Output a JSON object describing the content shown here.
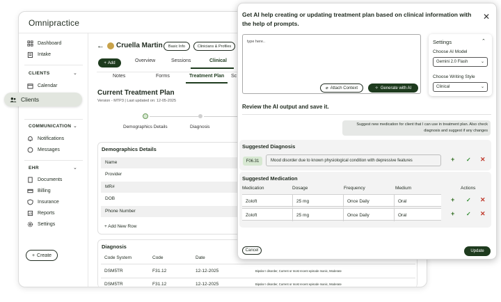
{
  "app": {
    "logo": "Omnipractice"
  },
  "sidebar": {
    "items": [
      {
        "label": "Dashboard",
        "icon": "grid-icon"
      },
      {
        "label": "Intake",
        "icon": "clipboard-icon"
      }
    ],
    "sections": [
      {
        "title": "CLIENTS",
        "items": [
          {
            "label": "Calendar",
            "icon": "calendar-icon"
          }
        ]
      },
      {
        "title": "COMMUNICATION",
        "items": [
          {
            "label": "Notifications",
            "icon": "bell-icon"
          },
          {
            "label": "Messages",
            "icon": "chat-icon"
          }
        ]
      },
      {
        "title": "EHR",
        "items": [
          {
            "label": "Documents",
            "icon": "document-icon"
          },
          {
            "label": "Billing",
            "icon": "billing-icon"
          },
          {
            "label": "Insurance",
            "icon": "shield-icon"
          },
          {
            "label": "Reports",
            "icon": "reports-icon"
          },
          {
            "label": "Settings",
            "icon": "gear-icon"
          }
        ]
      }
    ],
    "create_label": "Create",
    "clients_pill": "Clients"
  },
  "patient": {
    "name": "Cruella Martin",
    "basic_info": "Basic Info",
    "clinicians": "Clinicians & Profiles",
    "add_label": "Add"
  },
  "tabs_primary": [
    "Overview",
    "Sessions",
    "Clinical"
  ],
  "tabs_secondary": [
    "Notes",
    "Forms",
    "Treatment Plan",
    "Sc"
  ],
  "plan": {
    "title": "Current Treatment Plan",
    "version": "Version - MTP3 | Last updated on: 12-05-2025",
    "steps": [
      "Demographics Details",
      "Diagnosis"
    ]
  },
  "demographics": {
    "title": "Demographics Details",
    "rows": [
      "Name",
      "Provider",
      "MR#",
      "DOB",
      "Phone Number"
    ],
    "add_row": "+ Add New Row"
  },
  "diagnosis": {
    "title": "Diagnosis",
    "headers": [
      "Code System",
      "Code",
      "Date"
    ],
    "rows": [
      {
        "system": "DSM5TR",
        "code": "F31.12",
        "date": "12-12-2025",
        "desc": "Bipolar I disorder, Current or most recent episode manic, Moderate"
      },
      {
        "system": "DSM5TR",
        "code": "F31.12",
        "date": "12-12-2025",
        "desc": "Bipolar I disorder, Current or most recent episode manic, Moderate"
      }
    ]
  },
  "modal": {
    "title": "Get AI help creating or updating treatment plan based on clinical information with the help of prompts.",
    "prompt_placeholder": "type here..",
    "attach_label": "Attach Context",
    "generate_label": "Generate with AI",
    "settings": {
      "title": "Settings",
      "model_label": "Choose AI Model",
      "model_value": "Gemini 2.0 Flash",
      "style_label": "Choose Writing Style",
      "style_value": "Clinical"
    },
    "review_title": "Review the AI output and save it.",
    "user_prompt": "Suggest new medication for client  that I can use in treatment plan. Also check diagnosis and suggest if any changes",
    "suggested_diagnosis": {
      "title": "Suggested Diagnosis",
      "code": "F06.31",
      "desc": "Mood disorder due to known physiological condition with depressive features"
    },
    "suggested_medication": {
      "title": "Suggested Medication",
      "headers": [
        "Medication",
        "Dosage",
        "Frequency",
        "Medium",
        "Actions"
      ],
      "rows": [
        {
          "medication": "Zoloft",
          "dosage": "25 mg",
          "frequency": "Once Daily",
          "medium": "Oral"
        },
        {
          "medication": "Zoloft",
          "dosage": "25 mg",
          "frequency": "Once Daily",
          "medium": "Oral"
        }
      ]
    },
    "cancel_label": "Cancel",
    "update_label": "Update"
  }
}
